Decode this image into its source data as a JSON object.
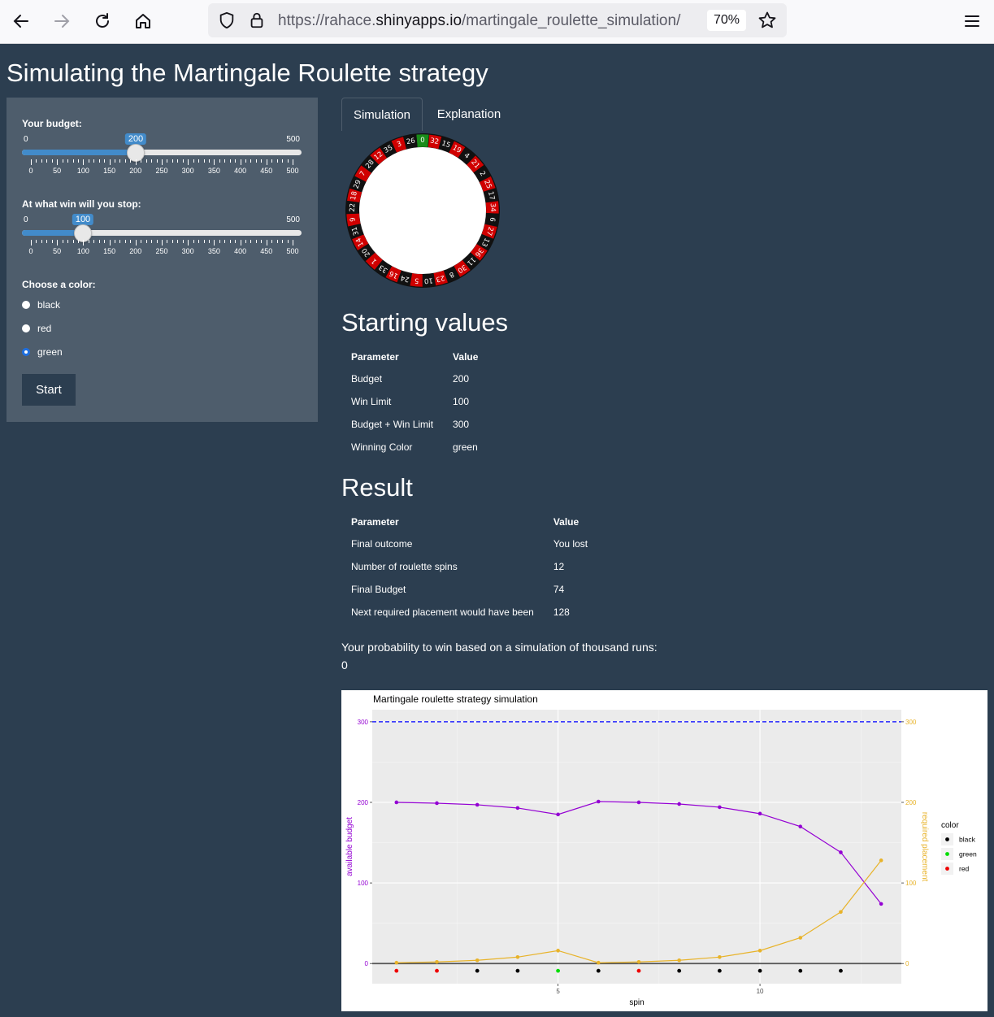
{
  "browser": {
    "url_prefix": "https://rahace.",
    "url_host": "shinyapps.io",
    "url_path": "/martingale_roulette_simulation/",
    "zoom": "70%"
  },
  "page": {
    "title": "Simulating the Martingale Roulette strategy"
  },
  "sidebar": {
    "budget": {
      "label": "Your budget:",
      "min": "0",
      "max": "500",
      "value": "200",
      "ticks": [
        "0",
        "50",
        "100",
        "150",
        "200",
        "250",
        "300",
        "350",
        "400",
        "450",
        "500"
      ]
    },
    "stopwin": {
      "label": "At what win will you stop:",
      "min": "0",
      "max": "500",
      "value": "100",
      "ticks": [
        "0",
        "50",
        "100",
        "150",
        "200",
        "250",
        "300",
        "350",
        "400",
        "450",
        "500"
      ]
    },
    "color_label": "Choose a color:",
    "colors": [
      {
        "label": "black",
        "checked": false
      },
      {
        "label": "red",
        "checked": false
      },
      {
        "label": "green",
        "checked": true
      }
    ],
    "start_label": "Start"
  },
  "tabs": [
    {
      "label": "Simulation",
      "active": true
    },
    {
      "label": "Explanation",
      "active": false
    }
  ],
  "wheel": {
    "numbers": [
      "0",
      "32",
      "15",
      "19",
      "4",
      "21",
      "2",
      "25",
      "17",
      "34",
      "6",
      "27",
      "13",
      "36",
      "11",
      "30",
      "8",
      "23",
      "10",
      "5",
      "24",
      "16",
      "33",
      "1",
      "20",
      "14",
      "31",
      "9",
      "22",
      "18",
      "29",
      "7",
      "28",
      "12",
      "35",
      "3",
      "26"
    ],
    "colors": {
      "red": "#d00000",
      "black": "#111111",
      "green": "#1a8c1a"
    }
  },
  "starting": {
    "heading": "Starting values",
    "headers": [
      "Parameter",
      "Value"
    ],
    "rows": [
      [
        "Budget",
        "200"
      ],
      [
        "Win Limit",
        "100"
      ],
      [
        "Budget + Win Limit",
        "300"
      ],
      [
        "Winning Color",
        "green"
      ]
    ]
  },
  "result": {
    "heading": "Result",
    "headers": [
      "Parameter",
      "Value"
    ],
    "rows": [
      [
        "Final outcome",
        "You lost"
      ],
      [
        "Number of roulette spins",
        "12"
      ],
      [
        "Final Budget",
        "74"
      ],
      [
        "Next required placement would have been",
        "128"
      ]
    ]
  },
  "probability": {
    "text": "Your probability to win based on a simulation of thousand runs:",
    "value": "0"
  },
  "chart_data": {
    "type": "line",
    "title": "Martingale roulette strategy simulation",
    "xlabel": "spin",
    "ylabel": "available budget",
    "y2label": "required placement",
    "xlim": [
      0.4,
      13.5
    ],
    "ylim": [
      -25,
      315
    ],
    "x_ticks": [
      5,
      10
    ],
    "y_ticks": [
      0,
      100,
      200,
      300
    ],
    "y2_ticks": [
      0,
      100,
      200,
      300
    ],
    "hline": {
      "y": 300,
      "color": "#0000ff",
      "style": "dashed"
    },
    "zero_line": 0,
    "series": [
      {
        "name": "available budget",
        "color": "#9400d3",
        "x": [
          1,
          2,
          3,
          4,
          5,
          6,
          7,
          8,
          9,
          10,
          11,
          12,
          13
        ],
        "values": [
          200,
          199,
          197,
          193,
          185,
          201,
          200,
          198,
          194,
          186,
          170,
          138,
          74
        ]
      },
      {
        "name": "required placement",
        "color": "#e8b32a",
        "x": [
          1,
          2,
          3,
          4,
          5,
          6,
          7,
          8,
          9,
          10,
          11,
          12,
          13
        ],
        "values": [
          1,
          2,
          4,
          8,
          16,
          1,
          2,
          4,
          8,
          16,
          32,
          64,
          128
        ]
      }
    ],
    "spin_colors": {
      "y": -9,
      "x": [
        1,
        2,
        3,
        4,
        5,
        6,
        7,
        8,
        9,
        10,
        11,
        12
      ],
      "colors": [
        "red",
        "red",
        "black",
        "black",
        "green",
        "black",
        "red",
        "black",
        "black",
        "black",
        "black",
        "black"
      ]
    },
    "legend": {
      "title": "color",
      "position": "right",
      "entries": [
        {
          "label": "black",
          "color": "#000000"
        },
        {
          "label": "green",
          "color": "#00dd00"
        },
        {
          "label": "red",
          "color": "#ee0000"
        }
      ]
    },
    "panel_bg": "#ebebeb",
    "grid": true
  }
}
